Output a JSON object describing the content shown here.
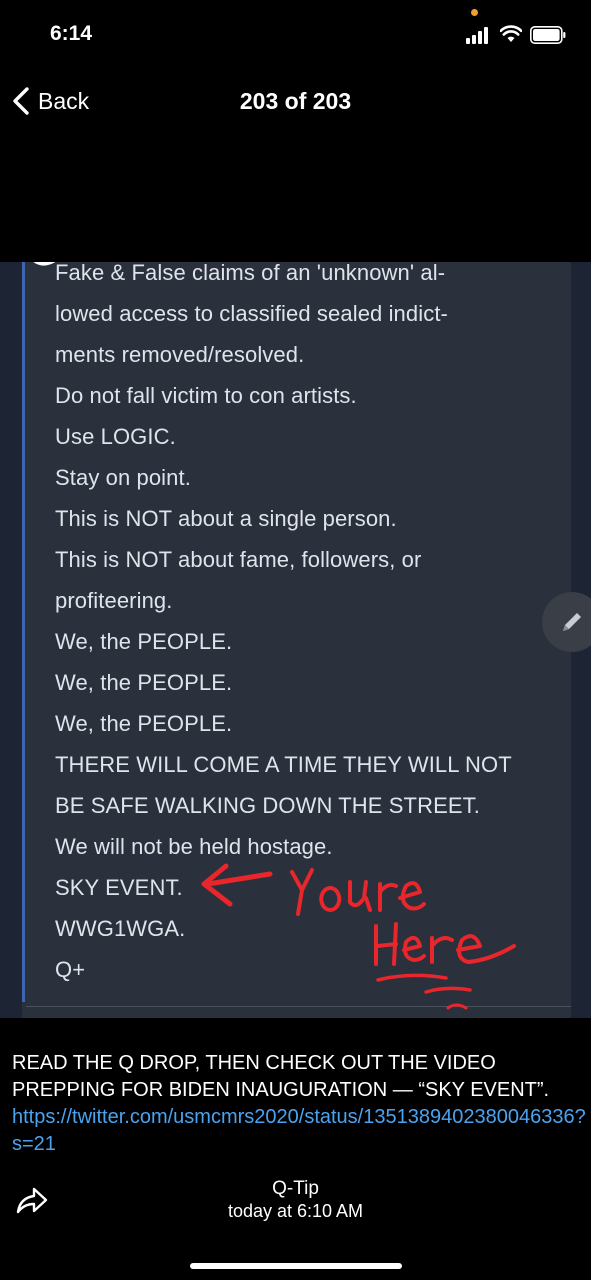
{
  "status_bar": {
    "time": "6:14",
    "icons": [
      "signal-icon",
      "wifi-icon",
      "battery-icon"
    ],
    "indicator_color": "#f29b38"
  },
  "nav": {
    "back_label": "Back",
    "title": "203 of 203"
  },
  "photo": {
    "lines": [
      "Fake & False claims of an 'unknown' al-",
      "lowed access to classified sealed indict-",
      "ments removed/resolved.",
      "Do not fall victim to con artists.",
      "Use LOGIC.",
      "Stay on point.",
      "This is NOT about a single person.",
      "This is NOT about fame, followers, or",
      "profiteering.",
      "We, the PEOPLE.",
      "We, the PEOPLE.",
      "We, the PEOPLE.",
      "THERE WILL COME A TIME THEY WILL NOT",
      "BE SAFE WALKING DOWN THE STREET.",
      "We will not be held hostage.",
      "SKY EVENT.",
      "WWG1WGA.",
      "Q+"
    ],
    "annotation_text": "Youre Here",
    "annotation_color": "#e8262b",
    "accent_rule_color": "#3c67b0"
  },
  "caption": {
    "text": "READ THE Q DROP, THEN CHECK OUT THE VIDEO PREPPING FOR BIDEN INAUGURATION — “SKY EVENT”.",
    "link": "https://twitter.com/usmcmrs2020/status/1351389402380046336?s=21"
  },
  "footer": {
    "sender": "Q-Tip",
    "time": "today at 6:10 AM"
  }
}
